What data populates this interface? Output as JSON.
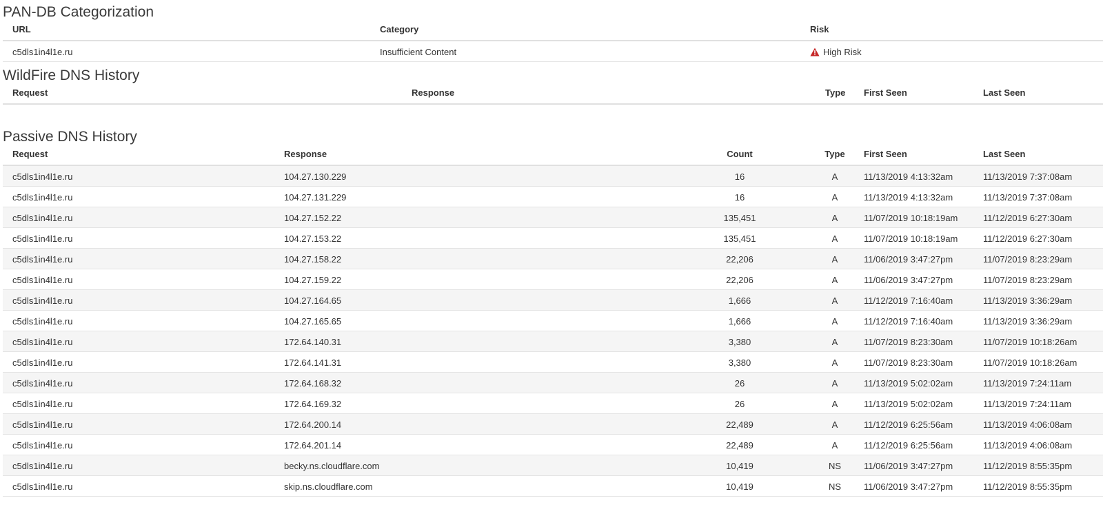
{
  "pandb": {
    "title": "PAN-DB Categorization",
    "headers": {
      "url": "URL",
      "category": "Category",
      "risk": "Risk"
    },
    "row": {
      "url": "c5dls1in4l1e.ru",
      "category": "Insufficient Content",
      "risk": "High Risk"
    },
    "risk_color": "#c62828"
  },
  "wildfire": {
    "title": "WildFire DNS History",
    "headers": {
      "request": "Request",
      "response": "Response",
      "type": "Type",
      "first_seen": "First Seen",
      "last_seen": "Last Seen"
    }
  },
  "passive": {
    "title": "Passive DNS History",
    "headers": {
      "request": "Request",
      "response": "Response",
      "count": "Count",
      "type": "Type",
      "first_seen": "First Seen",
      "last_seen": "Last Seen"
    },
    "rows": [
      {
        "request": "c5dls1in4l1e.ru",
        "response": "104.27.130.229",
        "count": "16",
        "type": "A",
        "first_seen": "11/13/2019 4:13:32am",
        "last_seen": "11/13/2019 7:37:08am"
      },
      {
        "request": "c5dls1in4l1e.ru",
        "response": "104.27.131.229",
        "count": "16",
        "type": "A",
        "first_seen": "11/13/2019 4:13:32am",
        "last_seen": "11/13/2019 7:37:08am"
      },
      {
        "request": "c5dls1in4l1e.ru",
        "response": "104.27.152.22",
        "count": "135,451",
        "type": "A",
        "first_seen": "11/07/2019 10:18:19am",
        "last_seen": "11/12/2019 6:27:30am"
      },
      {
        "request": "c5dls1in4l1e.ru",
        "response": "104.27.153.22",
        "count": "135,451",
        "type": "A",
        "first_seen": "11/07/2019 10:18:19am",
        "last_seen": "11/12/2019 6:27:30am"
      },
      {
        "request": "c5dls1in4l1e.ru",
        "response": "104.27.158.22",
        "count": "22,206",
        "type": "A",
        "first_seen": "11/06/2019 3:47:27pm",
        "last_seen": "11/07/2019 8:23:29am"
      },
      {
        "request": "c5dls1in4l1e.ru",
        "response": "104.27.159.22",
        "count": "22,206",
        "type": "A",
        "first_seen": "11/06/2019 3:47:27pm",
        "last_seen": "11/07/2019 8:23:29am"
      },
      {
        "request": "c5dls1in4l1e.ru",
        "response": "104.27.164.65",
        "count": "1,666",
        "type": "A",
        "first_seen": "11/12/2019 7:16:40am",
        "last_seen": "11/13/2019 3:36:29am"
      },
      {
        "request": "c5dls1in4l1e.ru",
        "response": "104.27.165.65",
        "count": "1,666",
        "type": "A",
        "first_seen": "11/12/2019 7:16:40am",
        "last_seen": "11/13/2019 3:36:29am"
      },
      {
        "request": "c5dls1in4l1e.ru",
        "response": "172.64.140.31",
        "count": "3,380",
        "type": "A",
        "first_seen": "11/07/2019 8:23:30am",
        "last_seen": "11/07/2019 10:18:26am"
      },
      {
        "request": "c5dls1in4l1e.ru",
        "response": "172.64.141.31",
        "count": "3,380",
        "type": "A",
        "first_seen": "11/07/2019 8:23:30am",
        "last_seen": "11/07/2019 10:18:26am"
      },
      {
        "request": "c5dls1in4l1e.ru",
        "response": "172.64.168.32",
        "count": "26",
        "type": "A",
        "first_seen": "11/13/2019 5:02:02am",
        "last_seen": "11/13/2019 7:24:11am"
      },
      {
        "request": "c5dls1in4l1e.ru",
        "response": "172.64.169.32",
        "count": "26",
        "type": "A",
        "first_seen": "11/13/2019 5:02:02am",
        "last_seen": "11/13/2019 7:24:11am"
      },
      {
        "request": "c5dls1in4l1e.ru",
        "response": "172.64.200.14",
        "count": "22,489",
        "type": "A",
        "first_seen": "11/12/2019 6:25:56am",
        "last_seen": "11/13/2019 4:06:08am"
      },
      {
        "request": "c5dls1in4l1e.ru",
        "response": "172.64.201.14",
        "count": "22,489",
        "type": "A",
        "first_seen": "11/12/2019 6:25:56am",
        "last_seen": "11/13/2019 4:06:08am"
      },
      {
        "request": "c5dls1in4l1e.ru",
        "response": "becky.ns.cloudflare.com",
        "count": "10,419",
        "type": "NS",
        "first_seen": "11/06/2019 3:47:27pm",
        "last_seen": "11/12/2019 8:55:35pm"
      },
      {
        "request": "c5dls1in4l1e.ru",
        "response": "skip.ns.cloudflare.com",
        "count": "10,419",
        "type": "NS",
        "first_seen": "11/06/2019 3:47:27pm",
        "last_seen": "11/12/2019 8:55:35pm"
      }
    ]
  },
  "icons": {
    "risk": "warning-triangle-icon"
  }
}
